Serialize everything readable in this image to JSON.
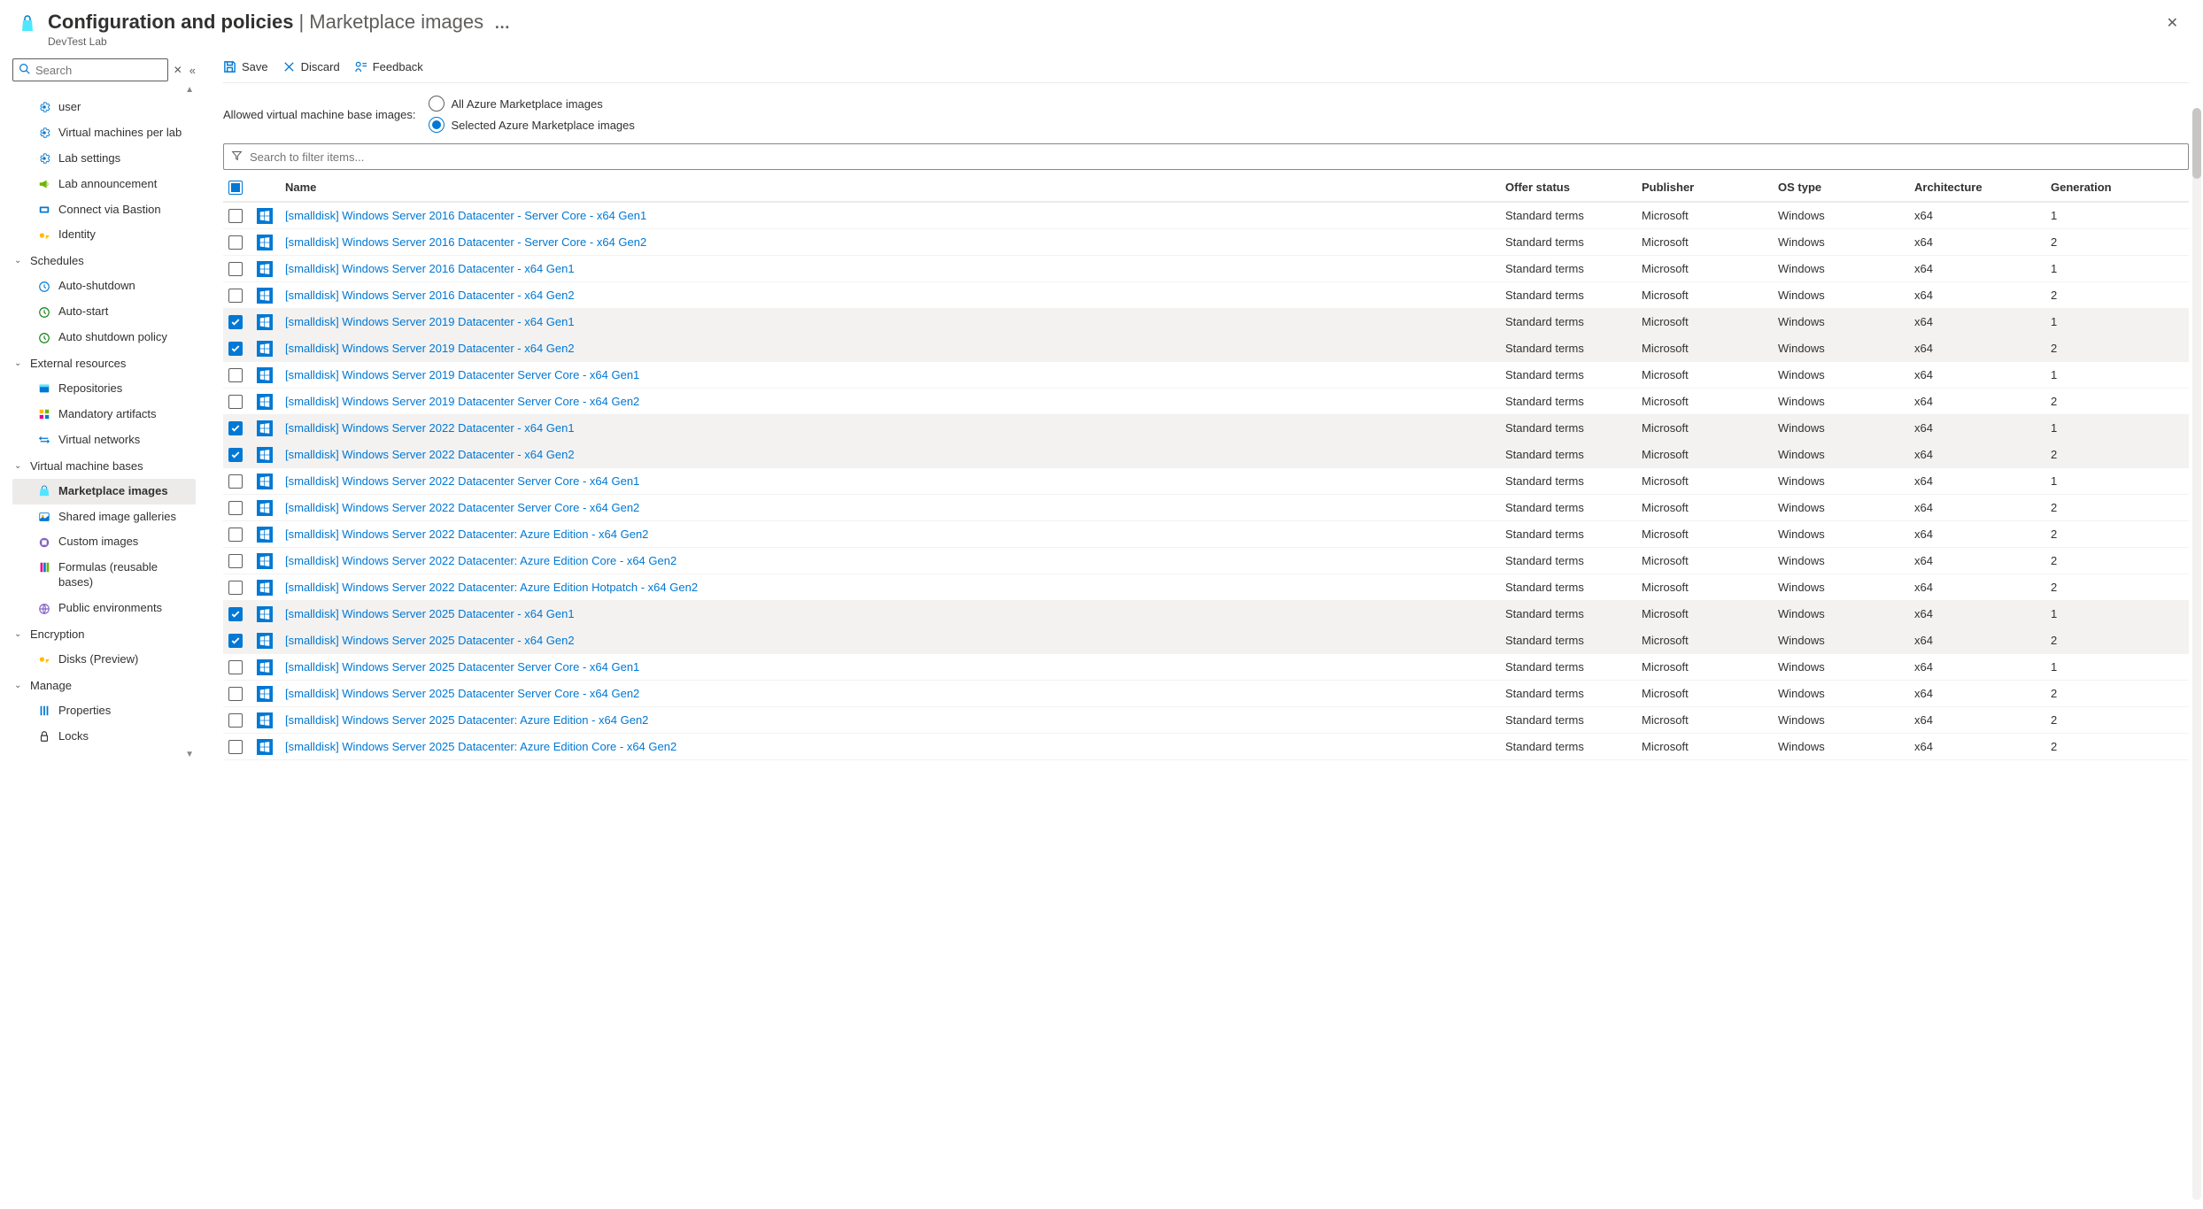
{
  "header": {
    "title_strong": "Configuration and policies",
    "title_sep": " | ",
    "title_light": "Marketplace images",
    "dots": "…",
    "subtitle": "DevTest Lab"
  },
  "sidebar": {
    "search_placeholder": "Search",
    "top_items": [
      {
        "label": "user",
        "wrap_prefix": ""
      },
      {
        "label": "Virtual machines per lab"
      },
      {
        "label": "Lab settings"
      },
      {
        "label": "Lab announcement"
      },
      {
        "label": "Connect via Bastion"
      },
      {
        "label": "Identity"
      }
    ],
    "groups": [
      {
        "label": "Schedules",
        "items": [
          "Auto-shutdown",
          "Auto-start",
          "Auto shutdown policy"
        ]
      },
      {
        "label": "External resources",
        "items": [
          "Repositories",
          "Mandatory artifacts",
          "Virtual networks"
        ]
      },
      {
        "label": "Virtual machine bases",
        "items": [
          "Marketplace images",
          "Shared image galleries",
          "Custom images",
          "Formulas (reusable bases)",
          "Public environments"
        ],
        "active_index": 0
      },
      {
        "label": "Encryption",
        "items": [
          "Disks (Preview)"
        ]
      },
      {
        "label": "Manage",
        "items": [
          "Properties",
          "Locks"
        ]
      }
    ]
  },
  "toolbar": {
    "save": "Save",
    "discard": "Discard",
    "feedback": "Feedback"
  },
  "options": {
    "label": "Allowed virtual machine base images:",
    "opt_all": "All Azure Marketplace images",
    "opt_selected": "Selected Azure Marketplace images"
  },
  "filter": {
    "placeholder": "Search to filter items..."
  },
  "columns": {
    "name": "Name",
    "offer": "Offer status",
    "publisher": "Publisher",
    "os": "OS type",
    "arch": "Architecture",
    "gen": "Generation"
  },
  "rows": [
    {
      "checked": false,
      "name": "[smalldisk] Windows Server 2016 Datacenter - Server Core - x64 Gen1",
      "offer": "Standard terms",
      "pub": "Microsoft",
      "os": "Windows",
      "arch": "x64",
      "gen": "1"
    },
    {
      "checked": false,
      "name": "[smalldisk] Windows Server 2016 Datacenter - Server Core - x64 Gen2",
      "offer": "Standard terms",
      "pub": "Microsoft",
      "os": "Windows",
      "arch": "x64",
      "gen": "2"
    },
    {
      "checked": false,
      "name": "[smalldisk] Windows Server 2016 Datacenter - x64 Gen1",
      "offer": "Standard terms",
      "pub": "Microsoft",
      "os": "Windows",
      "arch": "x64",
      "gen": "1"
    },
    {
      "checked": false,
      "name": "[smalldisk] Windows Server 2016 Datacenter - x64 Gen2",
      "offer": "Standard terms",
      "pub": "Microsoft",
      "os": "Windows",
      "arch": "x64",
      "gen": "2"
    },
    {
      "checked": true,
      "name": "[smalldisk] Windows Server 2019 Datacenter - x64 Gen1",
      "offer": "Standard terms",
      "pub": "Microsoft",
      "os": "Windows",
      "arch": "x64",
      "gen": "1"
    },
    {
      "checked": true,
      "name": "[smalldisk] Windows Server 2019 Datacenter - x64 Gen2",
      "offer": "Standard terms",
      "pub": "Microsoft",
      "os": "Windows",
      "arch": "x64",
      "gen": "2"
    },
    {
      "checked": false,
      "name": "[smalldisk] Windows Server 2019 Datacenter Server Core - x64 Gen1",
      "offer": "Standard terms",
      "pub": "Microsoft",
      "os": "Windows",
      "arch": "x64",
      "gen": "1"
    },
    {
      "checked": false,
      "name": "[smalldisk] Windows Server 2019 Datacenter Server Core - x64 Gen2",
      "offer": "Standard terms",
      "pub": "Microsoft",
      "os": "Windows",
      "arch": "x64",
      "gen": "2"
    },
    {
      "checked": true,
      "name": "[smalldisk] Windows Server 2022 Datacenter - x64 Gen1",
      "offer": "Standard terms",
      "pub": "Microsoft",
      "os": "Windows",
      "arch": "x64",
      "gen": "1"
    },
    {
      "checked": true,
      "name": "[smalldisk] Windows Server 2022 Datacenter - x64 Gen2",
      "offer": "Standard terms",
      "pub": "Microsoft",
      "os": "Windows",
      "arch": "x64",
      "gen": "2"
    },
    {
      "checked": false,
      "name": "[smalldisk] Windows Server 2022 Datacenter Server Core - x64 Gen1",
      "offer": "Standard terms",
      "pub": "Microsoft",
      "os": "Windows",
      "arch": "x64",
      "gen": "1"
    },
    {
      "checked": false,
      "name": "[smalldisk] Windows Server 2022 Datacenter Server Core - x64 Gen2",
      "offer": "Standard terms",
      "pub": "Microsoft",
      "os": "Windows",
      "arch": "x64",
      "gen": "2"
    },
    {
      "checked": false,
      "name": "[smalldisk] Windows Server 2022 Datacenter: Azure Edition - x64 Gen2",
      "offer": "Standard terms",
      "pub": "Microsoft",
      "os": "Windows",
      "arch": "x64",
      "gen": "2"
    },
    {
      "checked": false,
      "name": "[smalldisk] Windows Server 2022 Datacenter: Azure Edition Core - x64 Gen2",
      "offer": "Standard terms",
      "pub": "Microsoft",
      "os": "Windows",
      "arch": "x64",
      "gen": "2"
    },
    {
      "checked": false,
      "name": "[smalldisk] Windows Server 2022 Datacenter: Azure Edition Hotpatch - x64 Gen2",
      "offer": "Standard terms",
      "pub": "Microsoft",
      "os": "Windows",
      "arch": "x64",
      "gen": "2"
    },
    {
      "checked": true,
      "name": "[smalldisk] Windows Server 2025 Datacenter - x64 Gen1",
      "offer": "Standard terms",
      "pub": "Microsoft",
      "os": "Windows",
      "arch": "x64",
      "gen": "1"
    },
    {
      "checked": true,
      "name": "[smalldisk] Windows Server 2025 Datacenter - x64 Gen2",
      "offer": "Standard terms",
      "pub": "Microsoft",
      "os": "Windows",
      "arch": "x64",
      "gen": "2"
    },
    {
      "checked": false,
      "name": "[smalldisk] Windows Server 2025 Datacenter Server Core - x64 Gen1",
      "offer": "Standard terms",
      "pub": "Microsoft",
      "os": "Windows",
      "arch": "x64",
      "gen": "1"
    },
    {
      "checked": false,
      "name": "[smalldisk] Windows Server 2025 Datacenter Server Core - x64 Gen2",
      "offer": "Standard terms",
      "pub": "Microsoft",
      "os": "Windows",
      "arch": "x64",
      "gen": "2"
    },
    {
      "checked": false,
      "name": "[smalldisk] Windows Server 2025 Datacenter: Azure Edition - x64 Gen2",
      "offer": "Standard terms",
      "pub": "Microsoft",
      "os": "Windows",
      "arch": "x64",
      "gen": "2"
    },
    {
      "checked": false,
      "name": "[smalldisk] Windows Server 2025 Datacenter: Azure Edition Core - x64 Gen2",
      "offer": "Standard terms",
      "pub": "Microsoft",
      "os": "Windows",
      "arch": "x64",
      "gen": "2"
    }
  ]
}
